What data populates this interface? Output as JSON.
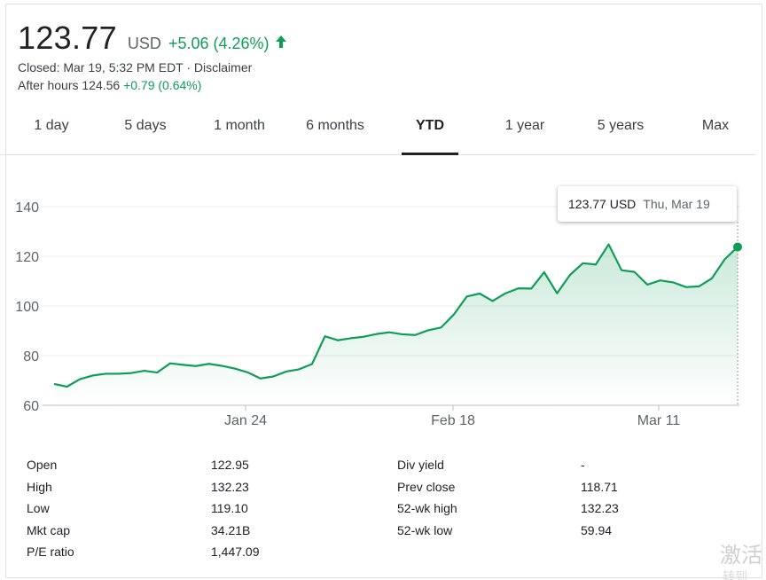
{
  "quote": {
    "price": "123.77",
    "currency": "USD",
    "change": "+5.06 (4.26%)",
    "closed": "Closed: Mar 19, 5:32 PM EDT · Disclaimer",
    "after_hours_label": "After hours 124.56",
    "after_hours_change": "+0.79 (0.64%)",
    "up_color": "#0f9d58"
  },
  "tabs": [
    {
      "label": "1 day"
    },
    {
      "label": "5 days"
    },
    {
      "label": "1 month"
    },
    {
      "label": "6 months"
    },
    {
      "label": "YTD"
    },
    {
      "label": "1 year"
    },
    {
      "label": "5 years"
    },
    {
      "label": "Max"
    }
  ],
  "active_tab": "YTD",
  "tooltip": {
    "value": "123.77 USD",
    "date": "Thu, Mar 19"
  },
  "chart_data": {
    "type": "area",
    "ylim": [
      60,
      140
    ],
    "yticks": [
      "140",
      "120",
      "100",
      "80",
      "60"
    ],
    "xticks": [
      "Jan 24",
      "Feb 18",
      "Mar 11"
    ],
    "line_color": "#0f9d58",
    "grid": true,
    "series": [
      {
        "values": [
          68.6,
          67.5,
          70.5,
          72.0,
          72.7,
          72.7,
          73.0,
          73.9,
          73.2,
          76.9,
          76.3,
          75.8,
          76.7,
          75.9,
          74.8,
          73.3,
          70.8,
          71.6,
          73.6,
          74.5,
          76.6,
          87.8,
          86.2,
          87.0,
          87.6,
          88.7,
          89.4,
          88.6,
          88.3,
          90.2,
          91.3,
          96.6,
          103.8,
          105.0,
          102.0,
          105.1,
          107.1,
          107.0,
          113.6,
          105.1,
          112.5,
          117.2,
          116.7,
          124.8,
          114.4,
          113.7,
          108.6,
          110.3,
          109.5,
          107.6,
          107.9,
          111.1,
          118.8,
          123.77
        ]
      }
    ]
  },
  "stats": {
    "left": [
      {
        "key": "Open",
        "value": "122.95"
      },
      {
        "key": "High",
        "value": "132.23"
      },
      {
        "key": "Low",
        "value": "119.10"
      },
      {
        "key": "Mkt cap",
        "value": "34.21B"
      },
      {
        "key": "P/E ratio",
        "value": "1,447.09"
      }
    ],
    "right": [
      {
        "key": "Div yield",
        "value": "-"
      },
      {
        "key": "Prev close",
        "value": "118.71"
      },
      {
        "key": "52-wk high",
        "value": "132.23"
      },
      {
        "key": "52-wk low",
        "value": "59.94"
      }
    ]
  },
  "watermark": {
    "line1": "激活",
    "line2": "转到"
  }
}
